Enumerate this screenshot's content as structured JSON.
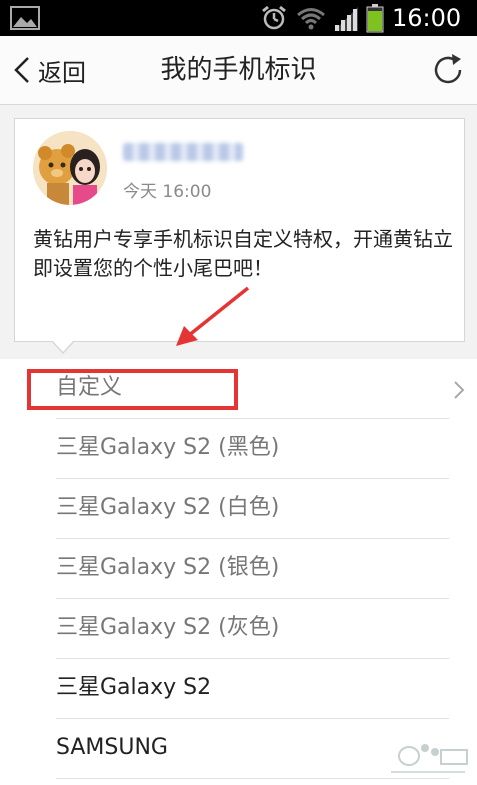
{
  "status_bar": {
    "time": "16:00",
    "icons": [
      "gallery-icon",
      "alarm-icon",
      "wifi-icon",
      "signal-icon",
      "battery-icon"
    ]
  },
  "nav": {
    "back_label": "返回",
    "title": "我的手机标识",
    "back_icon": "chevron-left-icon",
    "refresh_icon": "refresh-icon"
  },
  "card": {
    "time": "今天 16:00",
    "message": "黄钻用户专享手机标识自定义特权，开通黄钻立即设置您的个性小尾巴吧！"
  },
  "options": [
    {
      "label": "自定义",
      "style": "grey",
      "has_chevron": true,
      "highlighted": true
    },
    {
      "label": "三星Galaxy S2 (黑色)",
      "style": "grey"
    },
    {
      "label": "三星Galaxy S2 (白色)",
      "style": "grey"
    },
    {
      "label": "三星Galaxy S2 (银色)",
      "style": "grey"
    },
    {
      "label": "三星Galaxy S2 (灰色)",
      "style": "grey"
    },
    {
      "label": "三星Galaxy S2",
      "style": "dark"
    },
    {
      "label": "SAMSUNG",
      "style": "dark"
    }
  ],
  "colors": {
    "highlight": "#e43434",
    "battery": "#7dc21e"
  }
}
